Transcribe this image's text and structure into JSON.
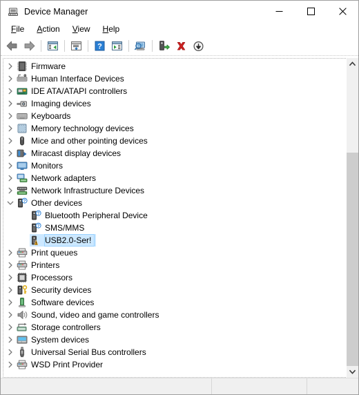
{
  "window": {
    "title": "Device Manager",
    "icon": "device-manager-icon",
    "controls": {
      "minimize": "minimize-icon",
      "maximize": "maximize-icon",
      "close": "close-icon"
    }
  },
  "menubar": {
    "items": [
      {
        "label": "File",
        "accel": "F"
      },
      {
        "label": "Action",
        "accel": "A"
      },
      {
        "label": "View",
        "accel": "V"
      },
      {
        "label": "Help",
        "accel": "H"
      }
    ]
  },
  "toolbar": {
    "buttons": [
      {
        "name": "back-button",
        "icon": "back-arrow-icon"
      },
      {
        "name": "forward-button",
        "icon": "forward-arrow-icon"
      },
      {
        "sep": true
      },
      {
        "name": "show-hide-console-tree-button",
        "icon": "console-tree-icon"
      },
      {
        "sep": true
      },
      {
        "name": "properties-button",
        "icon": "properties-icon"
      },
      {
        "sep": true
      },
      {
        "name": "help-button",
        "icon": "help-question-icon"
      },
      {
        "name": "show-hide-action-pane-button",
        "icon": "action-pane-icon"
      },
      {
        "sep": true
      },
      {
        "name": "scan-for-hardware-changes-button",
        "icon": "scan-hardware-icon"
      },
      {
        "sep": true
      },
      {
        "name": "update-driver-button",
        "icon": "update-driver-icon"
      },
      {
        "name": "uninstall-device-button",
        "icon": "red-x-icon"
      },
      {
        "name": "disable-device-button",
        "icon": "disable-down-arrow-icon"
      }
    ]
  },
  "tree": {
    "rows": [
      {
        "label": "Firmware",
        "icon": "firmware-chip-icon",
        "state": "collapsed",
        "level": 1
      },
      {
        "label": "Human Interface Devices",
        "icon": "hid-keyboard-icon",
        "state": "collapsed",
        "level": 1
      },
      {
        "label": "IDE ATA/ATAPI controllers",
        "icon": "ide-controller-icon",
        "state": "collapsed",
        "level": 1
      },
      {
        "label": "Imaging devices",
        "icon": "imaging-camera-icon",
        "state": "collapsed",
        "level": 1
      },
      {
        "label": "Keyboards",
        "icon": "keyboard-icon",
        "state": "collapsed",
        "level": 1
      },
      {
        "label": "Memory technology devices",
        "icon": "memory-card-icon",
        "state": "collapsed",
        "level": 1
      },
      {
        "label": "Mice and other pointing devices",
        "icon": "mouse-icon",
        "state": "collapsed",
        "level": 1
      },
      {
        "label": "Miracast display devices",
        "icon": "miracast-icon",
        "state": "collapsed",
        "level": 1
      },
      {
        "label": "Monitors",
        "icon": "monitor-icon",
        "state": "collapsed",
        "level": 1
      },
      {
        "label": "Network adapters",
        "icon": "network-adapter-icon",
        "state": "collapsed",
        "level": 1
      },
      {
        "label": "Network Infrastructure Devices",
        "icon": "network-infrastructure-icon",
        "state": "collapsed",
        "level": 1
      },
      {
        "label": "Other devices",
        "icon": "unknown-device-icon",
        "state": "expanded",
        "level": 1
      },
      {
        "label": "Bluetooth Peripheral Device",
        "icon": "unknown-device-icon",
        "state": "leaf",
        "level": 2
      },
      {
        "label": "SMS/MMS",
        "icon": "unknown-device-icon",
        "state": "leaf",
        "level": 2
      },
      {
        "label": "USB2.0-Ser!",
        "icon": "warning-device-icon",
        "state": "leaf",
        "level": 2,
        "selected": true
      },
      {
        "label": "Print queues",
        "icon": "printer-icon",
        "state": "collapsed",
        "level": 1
      },
      {
        "label": "Printers",
        "icon": "printer-icon",
        "state": "collapsed",
        "level": 1
      },
      {
        "label": "Processors",
        "icon": "processor-icon",
        "state": "collapsed",
        "level": 1
      },
      {
        "label": "Security devices",
        "icon": "security-key-icon",
        "state": "collapsed",
        "level": 1
      },
      {
        "label": "Software devices",
        "icon": "software-device-icon",
        "state": "collapsed",
        "level": 1
      },
      {
        "label": "Sound, video and game controllers",
        "icon": "speaker-icon",
        "state": "collapsed",
        "level": 1
      },
      {
        "label": "Storage controllers",
        "icon": "storage-controller-icon",
        "state": "collapsed",
        "level": 1
      },
      {
        "label": "System devices",
        "icon": "system-device-icon",
        "state": "collapsed",
        "level": 1
      },
      {
        "label": "Universal Serial Bus controllers",
        "icon": "usb-icon",
        "state": "collapsed",
        "level": 1
      },
      {
        "label": "WSD Print Provider",
        "icon": "printer-icon",
        "state": "collapsed",
        "level": 1
      }
    ]
  },
  "scrollbar": {
    "up_icon": "chevron-up-icon",
    "down_icon": "chevron-down-icon",
    "thumb_top_pct": 28,
    "thumb_height_pct": 72
  },
  "statusbar": {
    "panes": [
      "",
      "",
      ""
    ]
  },
  "colors": {
    "selection": "#cce8ff",
    "selection_border": "#99d1ff",
    "chrome": "#f0f0f0",
    "scrollbar_thumb": "#cdcdcd"
  }
}
